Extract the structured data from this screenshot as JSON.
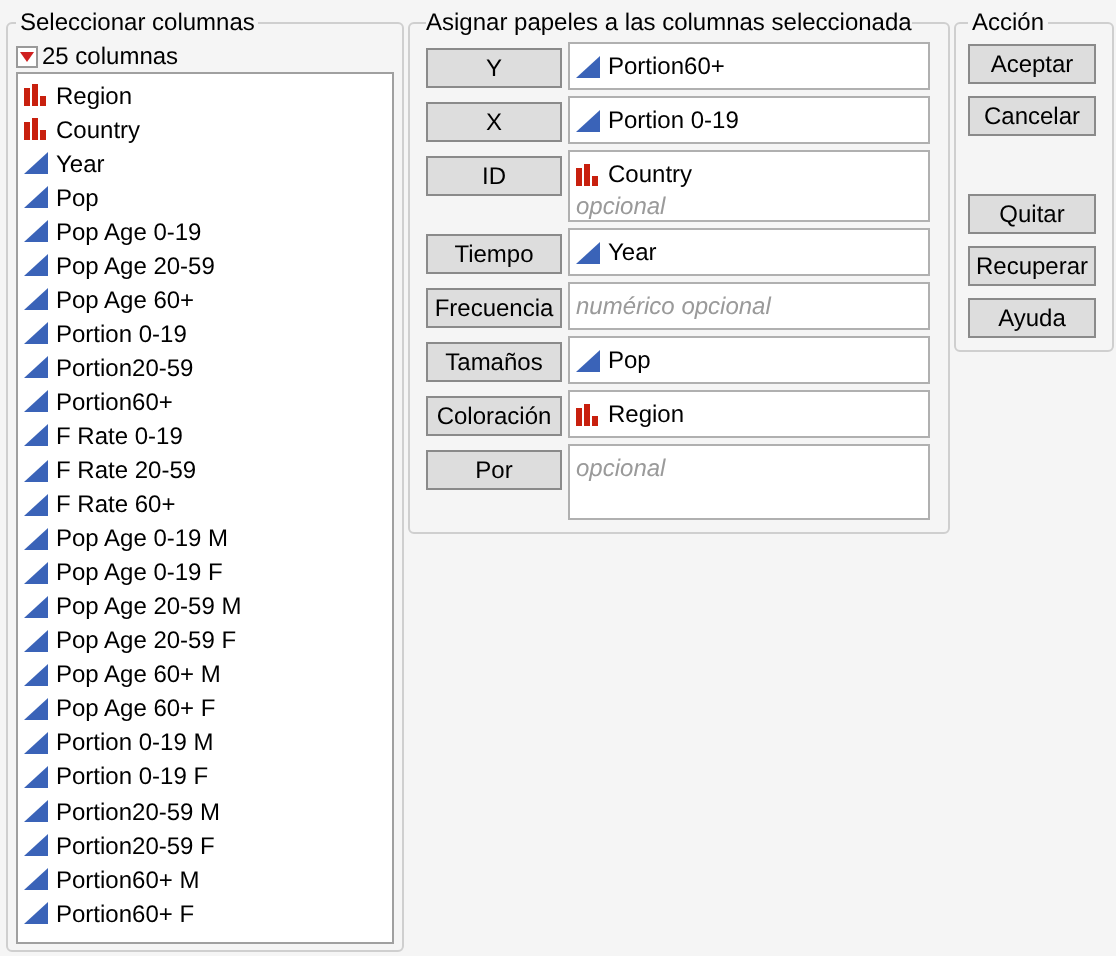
{
  "select_columns": {
    "title": "Seleccionar columnas",
    "count": "25 columnas",
    "columns": [
      {
        "name": "Region",
        "kind": "nominal"
      },
      {
        "name": "Country",
        "kind": "nominal"
      },
      {
        "name": "Year",
        "kind": "continuous"
      },
      {
        "name": "Pop",
        "kind": "continuous"
      },
      {
        "name": "Pop Age 0-19",
        "kind": "continuous"
      },
      {
        "name": "Pop Age 20-59",
        "kind": "continuous"
      },
      {
        "name": "Pop Age 60+",
        "kind": "continuous"
      },
      {
        "name": "Portion 0-19",
        "kind": "continuous"
      },
      {
        "name": "Portion20-59",
        "kind": "continuous"
      },
      {
        "name": "Portion60+",
        "kind": "continuous"
      },
      {
        "name": "F Rate 0-19",
        "kind": "continuous"
      },
      {
        "name": "F Rate 20-59",
        "kind": "continuous"
      },
      {
        "name": "F Rate 60+",
        "kind": "continuous"
      },
      {
        "name": "Pop Age 0-19 M",
        "kind": "continuous"
      },
      {
        "name": "Pop Age 0-19 F",
        "kind": "continuous"
      },
      {
        "name": "Pop Age 20-59 M",
        "kind": "continuous"
      },
      {
        "name": "Pop Age 20-59 F",
        "kind": "continuous"
      },
      {
        "name": "Pop Age 60+ M",
        "kind": "continuous"
      },
      {
        "name": "Pop Age 60+ F",
        "kind": "continuous"
      },
      {
        "name": "Portion 0-19 M",
        "kind": "continuous"
      },
      {
        "name": "Portion 0-19 F",
        "kind": "continuous"
      },
      {
        "name": "Portion20-59 M",
        "kind": "continuous"
      },
      {
        "name": "Portion20-59 F",
        "kind": "continuous"
      },
      {
        "name": "Portion60+ M",
        "kind": "continuous"
      },
      {
        "name": "Portion60+ F",
        "kind": "continuous"
      }
    ]
  },
  "roles": {
    "title": "Asignar papeles a las columnas seleccionada",
    "items": [
      {
        "label": "Y",
        "columns": [
          {
            "name": "Portion60+",
            "kind": "continuous"
          }
        ]
      },
      {
        "label": "X",
        "columns": [
          {
            "name": "Portion 0-19",
            "kind": "continuous"
          }
        ]
      },
      {
        "label": "ID",
        "columns": [
          {
            "name": "Country",
            "kind": "nominal"
          }
        ],
        "placeholder": "opcional"
      },
      {
        "label": "Tiempo",
        "columns": [
          {
            "name": "Year",
            "kind": "continuous"
          }
        ]
      },
      {
        "label": "Frecuencia",
        "placeholder": "numérico opcional"
      },
      {
        "label": "Tamaños",
        "columns": [
          {
            "name": "Pop",
            "kind": "continuous"
          }
        ]
      },
      {
        "label": "Coloración",
        "columns": [
          {
            "name": "Region",
            "kind": "nominal"
          }
        ]
      },
      {
        "label": "Por",
        "placeholder": "opcional",
        "tall": true
      }
    ]
  },
  "action": {
    "title": "Acción",
    "button_groups": [
      [
        "Aceptar",
        "Cancelar"
      ],
      [
        "Quitar",
        "Recuperar",
        "Ayuda"
      ]
    ]
  }
}
